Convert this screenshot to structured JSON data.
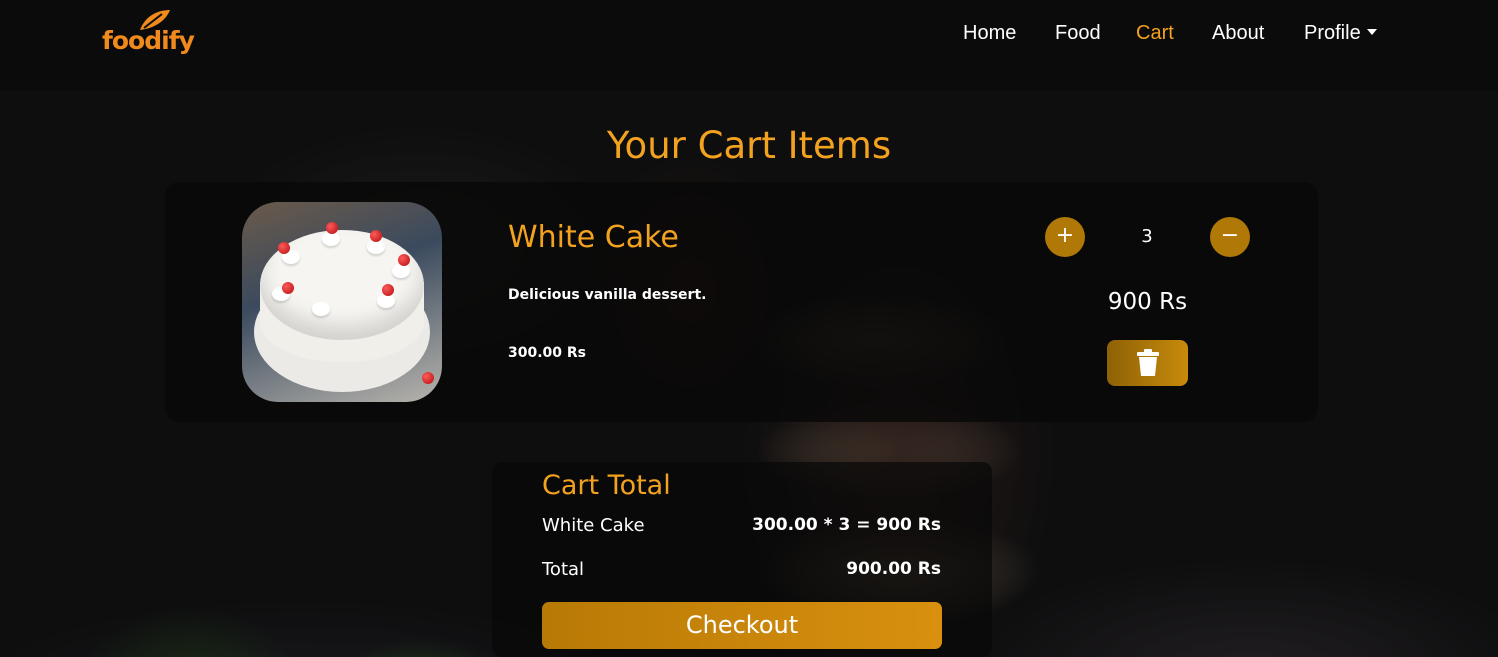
{
  "brand": {
    "name": "foodify",
    "accent": "#f08a1c"
  },
  "nav": {
    "links": [
      "Home",
      "Food",
      "Cart",
      "About",
      "Profile"
    ],
    "active": "Cart"
  },
  "page": {
    "title": "Your Cart Items"
  },
  "cart_items": [
    {
      "name": "White Cake",
      "description": "Delicious vanilla dessert.",
      "unit_price": "300.00 Rs",
      "quantity": "3",
      "line_total": "900 Rs",
      "increment_label": "+",
      "decrement_label": "−",
      "delete_icon": "trash-icon"
    }
  ],
  "cart_total": {
    "title": "Cart Total",
    "rows": [
      {
        "label": "White Cake",
        "value": "300.00 * 3 = 900 Rs"
      }
    ],
    "total_label": "Total",
    "total_value": "900.00 Rs",
    "checkout_label": "Checkout"
  },
  "colors": {
    "accent": "#f3a21f",
    "button": "#b07806",
    "background": "#0b0b0c"
  }
}
